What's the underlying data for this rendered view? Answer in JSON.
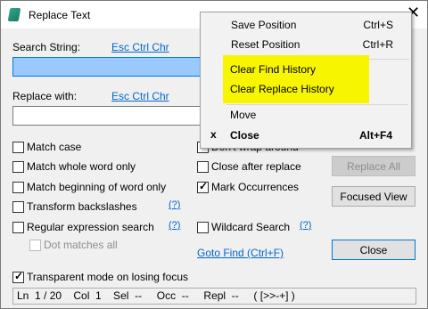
{
  "window": {
    "title": "Replace Text",
    "close_glyph": "✕"
  },
  "search": {
    "label": "Search String:",
    "esc_link": "Esc Ctrl Chr",
    "value": ""
  },
  "replace": {
    "label": "Replace with:",
    "esc_link": "Esc Ctrl Chr",
    "value": ""
  },
  "options": {
    "match_case": "Match case",
    "match_whole_word": "Match whole word only",
    "match_beginning": "Match beginning of word only",
    "transform_backslashes": "Transform backslashes",
    "regex": "Regular expression search",
    "dot_matches_all": "Dot matches all",
    "dont_wrap": "Don't wrap around",
    "close_after_replace": "Close after replace",
    "mark_occurrences": "Mark Occurrences",
    "wildcard": "Wildcard Search",
    "transparent": "Transparent mode on losing focus",
    "help": "(?)"
  },
  "links": {
    "goto_find": "Goto Find (Ctrl+F)"
  },
  "buttons": {
    "replace_all": "Replace All",
    "focused_view": "Focused View",
    "close": "Close"
  },
  "status": "Ln  1 / 20    Col  1    Sel  --     Occ  --     Repl  --     ( [>>-+] )",
  "menu": {
    "items": [
      {
        "label": "Save Position",
        "shortcut": "Ctrl+S"
      },
      {
        "label": "Reset Position",
        "shortcut": "Ctrl+R"
      },
      {
        "label": "Clear Find History",
        "shortcut": ""
      },
      {
        "label": "Clear Replace History",
        "shortcut": ""
      },
      {
        "label": "Move",
        "shortcut": ""
      },
      {
        "label": "Close",
        "shortcut": "Alt+F4",
        "mark": "x"
      }
    ],
    "highlight_color": "#f8f500"
  }
}
